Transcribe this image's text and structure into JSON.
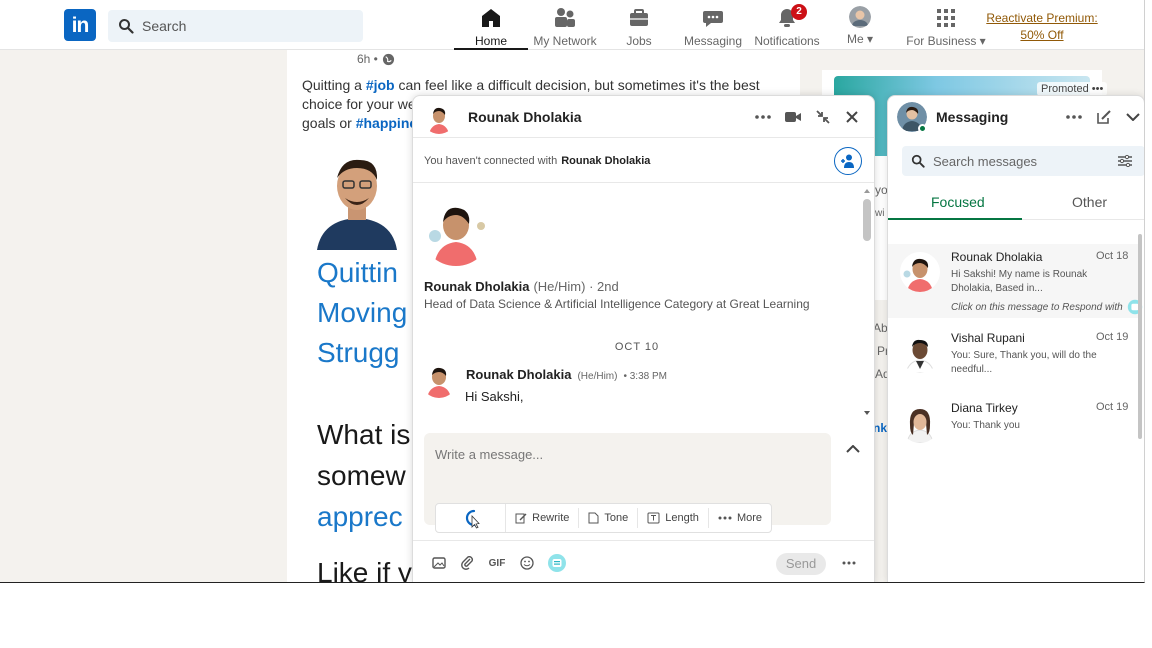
{
  "nav": {
    "logo": "in",
    "search_placeholder": "Search",
    "items": [
      {
        "label": "Home",
        "icon": "home-icon"
      },
      {
        "label": "My Network",
        "icon": "network-icon"
      },
      {
        "label": "Jobs",
        "icon": "briefcase-icon"
      },
      {
        "label": "Messaging",
        "icon": "chat-bubble-icon"
      },
      {
        "label": "Notifications",
        "icon": "bell-icon",
        "badge": "2"
      },
      {
        "label": "Me",
        "icon": "avatar"
      },
      {
        "label": "For Business",
        "icon": "grid-icon"
      }
    ],
    "premium_line1": "Reactivate Premium:",
    "premium_line2": "50% Off"
  },
  "post": {
    "time": "6h •",
    "text_a": "Quitting a ",
    "tag_job": "#job",
    "text_b": " can feel like a difficult decision, but sometimes it's the best choice for your well-being",
    "text_c": "goals or ",
    "tag_happiness": "#happines",
    "big_lines": [
      "Quittin",
      "Moving",
      "Strugg",
      "What is",
      "somew",
      "apprec",
      "Like if y"
    ]
  },
  "promo": {
    "label": "Promoted •••",
    "frags": [
      "yo",
      "wi",
      "Abo",
      "Pr",
      "Ad",
      "nke"
    ]
  },
  "chat": {
    "contact_name": "Rounak Dholakia",
    "notice_prefix": "You haven't connected with",
    "notice_name": "Rounak Dholakia",
    "profile_name": "Rounak Dholakia",
    "profile_pronouns": "(He/Him) · 2nd",
    "profile_headline": "Head of Data Science & Artificial Intelligence Category at Great Learning",
    "date_divider": "OCT 10",
    "msg_sender": "Rounak Dholakia",
    "msg_pronouns": "(He/Him)",
    "msg_time": "• 3:38 PM",
    "msg_text": "Hi Sakshi,",
    "composer_placeholder": "Write a message...",
    "ai_options": [
      "Rewrite",
      "Tone",
      "Length",
      "More"
    ],
    "tool_gif": "GIF",
    "send_label": "Send"
  },
  "messaging": {
    "title": "Messaging",
    "search_placeholder": "Search messages",
    "tabs": [
      "Focused",
      "Other"
    ],
    "conversations": [
      {
        "name": "Rounak Dholakia",
        "date": "Oct 18",
        "preview": "Hi Sakshi! My name is Rounak Dholakia, Based in...",
        "note": "Click on this message to Respond with"
      },
      {
        "name": "Vishal Rupani",
        "date": "Oct 19",
        "preview": "You:  Sure, Thank you, will do the needful...",
        "note": ""
      },
      {
        "name": "Diana Tirkey",
        "date": "Oct 19",
        "preview": "You: Thank you",
        "note": ""
      }
    ]
  },
  "colors": {
    "brand": "#0a66c2",
    "accent_green": "#057642",
    "badge_red": "#cc1016",
    "premium": "#915907"
  }
}
